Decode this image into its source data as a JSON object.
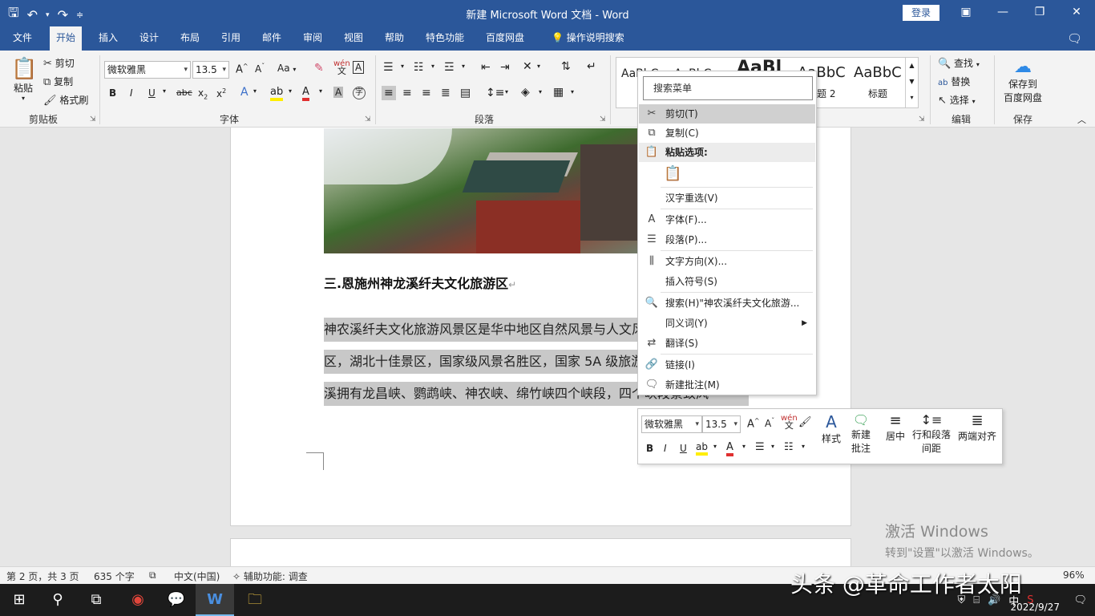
{
  "title_bar": {
    "doc_title": "新建 Microsoft Word 文档  -  Word",
    "login": "登录",
    "qat_icons": [
      "save-icon",
      "undo-icon",
      "redo-icon",
      "customize-icon"
    ]
  },
  "tabs": [
    "文件",
    "开始",
    "插入",
    "设计",
    "布局",
    "引用",
    "邮件",
    "审阅",
    "视图",
    "帮助",
    "特色功能",
    "百度网盘",
    "操作说明搜索"
  ],
  "active_tab": "开始",
  "ribbon": {
    "clipboard": {
      "paste": "粘贴",
      "cut": "剪切",
      "copy": "复制",
      "format_painter": "格式刷",
      "label": "剪贴板"
    },
    "font": {
      "family": "微软雅黑",
      "size": "13.5",
      "label": "字体",
      "case_btn": "Aa",
      "phonetic": "wén"
    },
    "paragraph": {
      "label": "段落"
    },
    "styles": {
      "preview1": "AaBbC",
      "preview2": "AaBbC",
      "preview3": "AaBl",
      "preview4": "AaBbC",
      "preview5": "AaBbC",
      "style4_label": "标题 2",
      "style5_label": "标题"
    },
    "editing": {
      "find": "查找",
      "replace": "替换",
      "select": "选择",
      "label": "编辑"
    },
    "save": {
      "line1": "保存到",
      "line2": "百度网盘",
      "label": "保存"
    }
  },
  "document": {
    "heading": "三.恩施州神龙溪纤夫文化旅游区",
    "lines": [
      "神农溪纤夫文化旅游风景区是华中地区自然风景与人文风情的旅游景",
      "区，湖北十佳景区，国家级风景名胜区，国家 5A 级旅游景区。神农",
      "溪拥有龙昌峡、鹦鹉峡、神农峡、绵竹峡四个峡段，四个峡段景致风"
    ]
  },
  "context_menu": {
    "search_placeholder": "搜索菜单",
    "cut": "剪切(T)",
    "copy": "复制(C)",
    "paste_options": "粘贴选项:",
    "reconvert": "汉字重选(V)",
    "font": "字体(F)...",
    "paragraph": "段落(P)...",
    "text_direction": "文字方向(X)...",
    "insert_symbol": "插入符号(S)",
    "search": "搜索(H)\"神农溪纤夫文化旅游...",
    "synonyms": "同义词(Y)",
    "translate": "翻译(S)",
    "link": "链接(I)",
    "new_comment": "新建批注(M)"
  },
  "mini_toolbar": {
    "font": "微软雅黑",
    "size": "13.5",
    "styles": "样式",
    "new_comment_l1": "新建",
    "new_comment_l2": "批注",
    "center": "居中",
    "spacing_l1": "行和段落",
    "spacing_l2": "间距",
    "justify": "两端对齐",
    "phonetic": "wén"
  },
  "watermark": {
    "line1": "激活 Windows",
    "line2": "转到\"设置\"以激活 Windows。"
  },
  "status_bar": {
    "page": "第 2 页，共 3 页",
    "words": "635 个字",
    "language": "中文(中国)",
    "accessibility": "辅助功能: 调查",
    "zoom": "96%"
  },
  "taskbar": {
    "ime": "中",
    "date": "2022/9/27",
    "overlay": "头条 @革命工作者太阳"
  },
  "colors": {
    "accent": "#2b579a",
    "highlight_red": "#e03030",
    "highlight_yellow": "#ffee00"
  }
}
